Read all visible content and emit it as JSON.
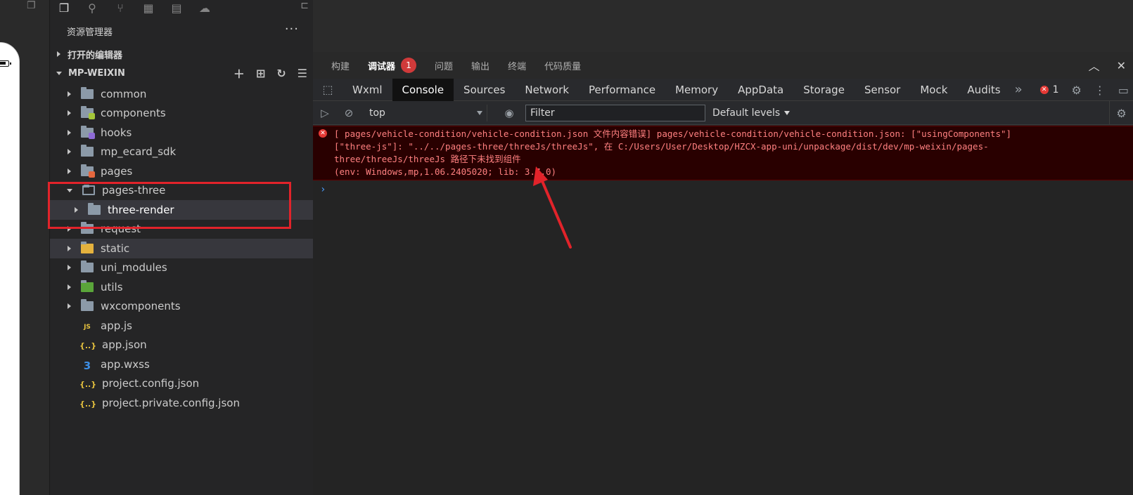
{
  "explorer": {
    "title": "资源管理器",
    "more": "···",
    "open_editors": "打开的编辑器",
    "project": "MP-WEIXIN"
  },
  "tree": [
    {
      "label": "common",
      "type": "folder",
      "badge": ""
    },
    {
      "label": "components",
      "type": "folder",
      "badge": "#a4c639"
    },
    {
      "label": "hooks",
      "type": "folder",
      "badge": "#8e6bd6"
    },
    {
      "label": "mp_ecard_sdk",
      "type": "folder",
      "badge": ""
    },
    {
      "label": "pages",
      "type": "folder",
      "badge": "#e5673e"
    },
    {
      "label": "pages-three",
      "type": "folder-open",
      "badge": ""
    },
    {
      "label": "three-render",
      "type": "folder-child",
      "badge": ""
    },
    {
      "label": "request",
      "type": "folder",
      "badge": ""
    },
    {
      "label": "static",
      "type": "folder",
      "badge": "#e5b23e"
    },
    {
      "label": "uni_modules",
      "type": "folder",
      "badge": ""
    },
    {
      "label": "utils",
      "type": "folder",
      "badge": "#5aa53a"
    },
    {
      "label": "wxcomponents",
      "type": "folder",
      "badge": ""
    },
    {
      "label": "app.js",
      "type": "js"
    },
    {
      "label": "app.json",
      "type": "json"
    },
    {
      "label": "app.wxss",
      "type": "css"
    },
    {
      "label": "project.config.json",
      "type": "json"
    },
    {
      "label": "project.private.config.json",
      "type": "json"
    }
  ],
  "panel_tabs": [
    "构建",
    "调试器",
    "问题",
    "输出",
    "终端",
    "代码质量"
  ],
  "panel_badge": "1",
  "devtabs": [
    "Wxml",
    "Console",
    "Sources",
    "Network",
    "Performance",
    "Memory",
    "AppData",
    "Storage",
    "Sensor",
    "Mock",
    "Audits"
  ],
  "devtabs_more": "»",
  "error_count": "1",
  "toolbar": {
    "context": "top",
    "filter_placeholder": "Filter",
    "levels": "Default levels"
  },
  "error": {
    "line1": "[ pages/vehicle-condition/vehicle-condition.json 文件内容错误] pages/vehicle-condition/vehicle-condition.json: [\"usingComponents\"]",
    "line2": "[\"three-js\"]: \"../../pages-three/threeJs/threeJs\", 在 C:/Users/User/Desktop/HZCX-app-uni/unpackage/dist/dev/mp-weixin/pages-",
    "line3": "three/threeJs/threeJs 路径下未找到组件",
    "line4": "(env: Windows,mp,1.06.2405020; lib: 3.7.0)"
  },
  "prompt": "›",
  "colors": {
    "accent_red": "#e2232a",
    "error_bg": "#290000",
    "error_text": "#ff8080"
  }
}
